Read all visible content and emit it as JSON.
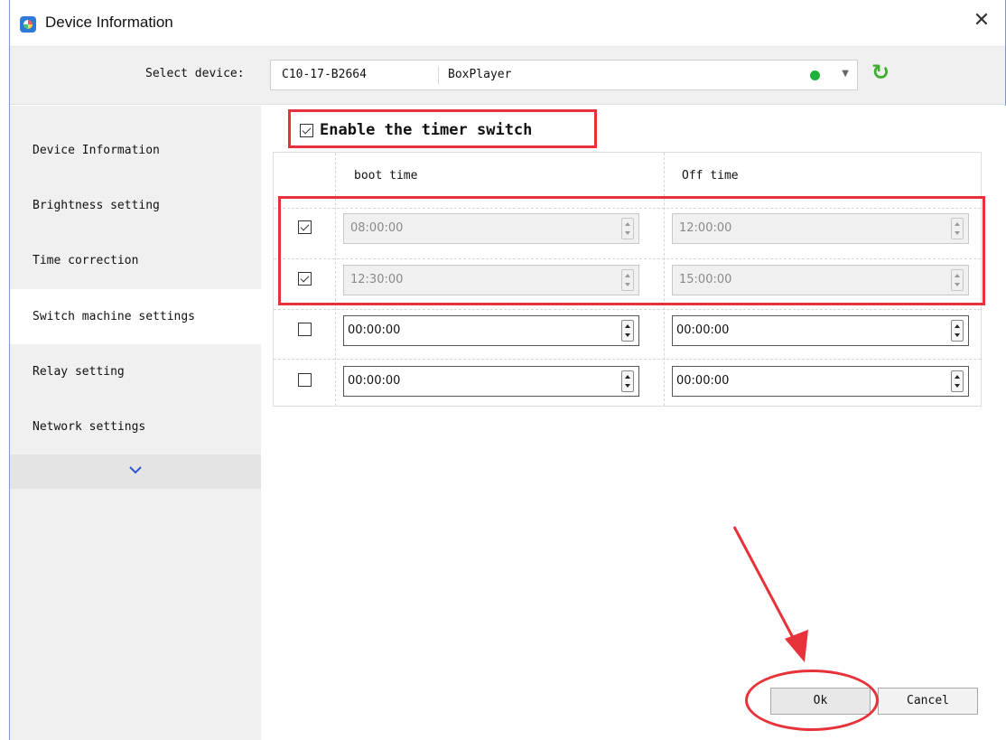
{
  "window": {
    "title": "Device Information",
    "close_icon": "close-icon",
    "app_icon": "app-logo-icon"
  },
  "device_bar": {
    "label": "Select device:",
    "device_id": "C10-17-B2664",
    "device_name": "BoxPlayer",
    "status_color": "#1db33a",
    "dropdown_icon": "chevron-down-icon",
    "refresh_icon": "refresh-icon",
    "refresh_color": "#3fae2f"
  },
  "sidebar": {
    "items": [
      {
        "label": "Device Information"
      },
      {
        "label": "Brightness setting"
      },
      {
        "label": "Time correction"
      },
      {
        "label": "Switch machine settings",
        "active": true
      },
      {
        "label": "Relay setting"
      },
      {
        "label": "Network settings"
      }
    ],
    "more_icon": "chevron-down-icon"
  },
  "timer": {
    "enable_label": "Enable the timer switch",
    "enabled": true,
    "columns": {
      "boot": "boot time",
      "off": "Off time"
    },
    "rows": [
      {
        "checked": true,
        "boot": "08:00:00",
        "off": "12:00:00"
      },
      {
        "checked": true,
        "boot": "12:30:00",
        "off": "15:00:00"
      },
      {
        "checked": false,
        "boot": "00:00:00",
        "off": "00:00:00"
      },
      {
        "checked": false,
        "boot": "00:00:00",
        "off": "00:00:00"
      }
    ]
  },
  "buttons": {
    "ok": "Ok",
    "cancel": "Cancel"
  },
  "annotation_color": "#e8323a"
}
